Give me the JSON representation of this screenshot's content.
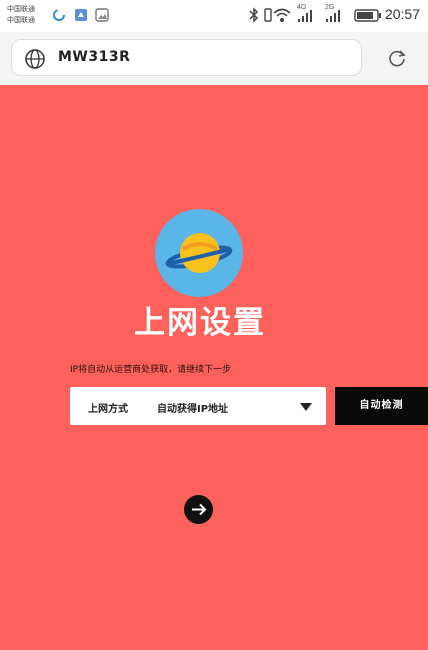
{
  "status_bar": {
    "carrier_line1": "中国联通",
    "carrier_line2": "中国联通",
    "net1": "4G",
    "net2": "2G",
    "time": "20:57",
    "icons": [
      "loading-icon",
      "app-icon",
      "image-icon",
      "bluetooth-icon",
      "vibrate-icon",
      "wifi-icon",
      "signal-icon",
      "battery-icon"
    ]
  },
  "browser": {
    "url": "MW313R",
    "icons": [
      "globe-icon",
      "reload-icon"
    ]
  },
  "page": {
    "title": "上网设置",
    "hint": "IP将自动从运营商处获取，请继续下一步",
    "connection_label": "上网方式",
    "connection_value": "自动获得IP地址",
    "detect_button": "自动检测",
    "next_icon": "arrow-right-icon",
    "logo_icon": "planet-icon",
    "colors": {
      "background": "#fd615b",
      "logo_circle": "#5ab6e8",
      "planet": "#f7c21d",
      "button_dark": "#0a0a0a"
    }
  }
}
